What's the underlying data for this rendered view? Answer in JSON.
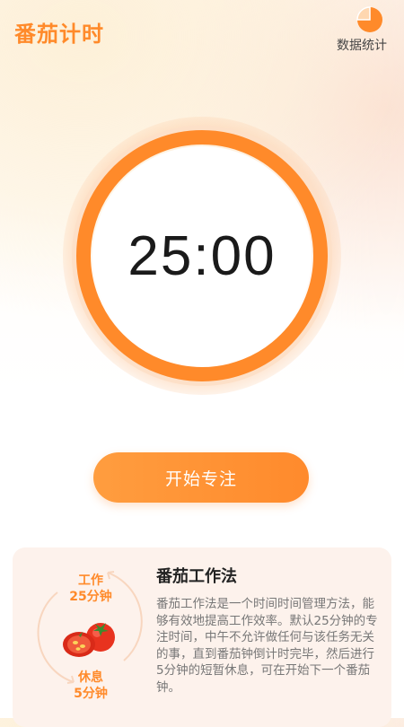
{
  "header": {
    "title": "番茄计时",
    "stats_label": "数据统计",
    "stats_icon": "pie-chart-icon"
  },
  "timer": {
    "display": "25:00",
    "ring_color": "#ff8a2a"
  },
  "actions": {
    "start_label": "开始专注"
  },
  "info_card": {
    "work_line1": "工作",
    "work_line2": "25分钟",
    "rest_line1": "休息",
    "rest_line2": "5分钟",
    "illustration_icon": "tomato-icon",
    "title": "番茄工作法",
    "body": "番茄工作法是一个时间时间管理方法，能够有效地提高工作效率。默认25分钟的专注时间，中午不允许做任何与该任务无关的事，直到番茄钟倒计时完毕，然后进行5分钟的短暂休息，可在开始下一个番茄钟。"
  },
  "colors": {
    "accent": "#ff8a2a",
    "card_bg": "#fdf2ec"
  }
}
